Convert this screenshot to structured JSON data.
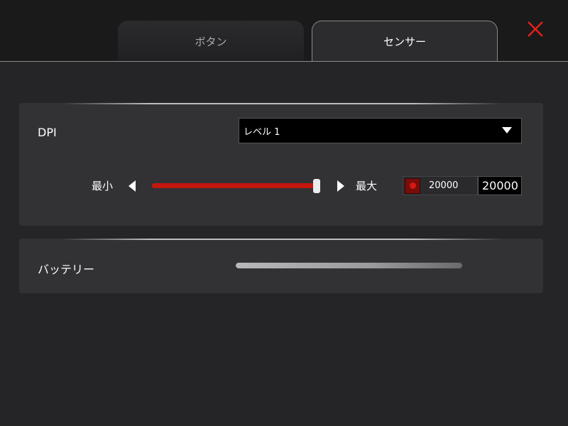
{
  "tabs": [
    {
      "label": "ボタン",
      "active": false
    },
    {
      "label": "センサー",
      "active": true
    }
  ],
  "close_icon": "close-x-icon",
  "dpi": {
    "label": "DPI",
    "level_select": {
      "selected": "レベル 1"
    },
    "min_label": "最小",
    "max_label": "最大",
    "slider_fraction": 1.0,
    "readout": "20000",
    "input_value": "20000",
    "level_color": "#d51a12"
  },
  "battery": {
    "label": "バッテリー",
    "level_fraction": 1.0
  },
  "colors": {
    "accent": "#c3170f",
    "close": "#e3201b",
    "background": "#252527"
  }
}
